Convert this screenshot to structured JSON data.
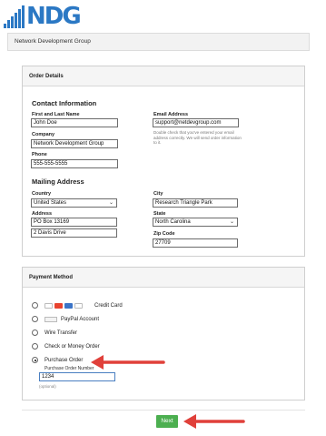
{
  "brand": {
    "logo_text": "NDG",
    "color": "#2b78c4"
  },
  "header": {
    "title": "Network Development Group"
  },
  "order_details": {
    "panel_title": "Order Details",
    "contact": {
      "section_title": "Contact Information",
      "name_label": "First and Last Name",
      "name_value": "John Doe",
      "company_label": "Company",
      "company_value": "Network Development Group",
      "phone_label": "Phone",
      "phone_value": "555-555-5555",
      "email_label": "Email Address",
      "email_value": "support@netdevgroup.com",
      "email_note": "Double check that you've entered your email address correctly. We will send order information to it."
    },
    "mailing": {
      "section_title": "Mailing Address",
      "country_label": "Country",
      "country_value": "United States",
      "address_label": "Address",
      "address_line1": "PO Box 13169",
      "address_line2": "2 Davis Drive",
      "city_label": "City",
      "city_value": "Research Triangle Park",
      "state_label": "State",
      "state_value": "North Carolina",
      "zip_label": "Zip Code",
      "zip_value": "27709"
    }
  },
  "payment": {
    "panel_title": "Payment Method",
    "options": [
      {
        "label": "Credit Card",
        "selected": false
      },
      {
        "label": "PayPal Account",
        "selected": false
      },
      {
        "label": "Wire Transfer",
        "selected": false
      },
      {
        "label": "Check or Money Order",
        "selected": false
      },
      {
        "label": "Purchase Order",
        "selected": true
      }
    ],
    "po_number_label": "Purchase Order Number",
    "po_number_value": "1234",
    "po_optional": "(optional)"
  },
  "footer": {
    "next_label": "Next",
    "next_color": "#4caf50"
  },
  "arrow_color": "#e0403a"
}
